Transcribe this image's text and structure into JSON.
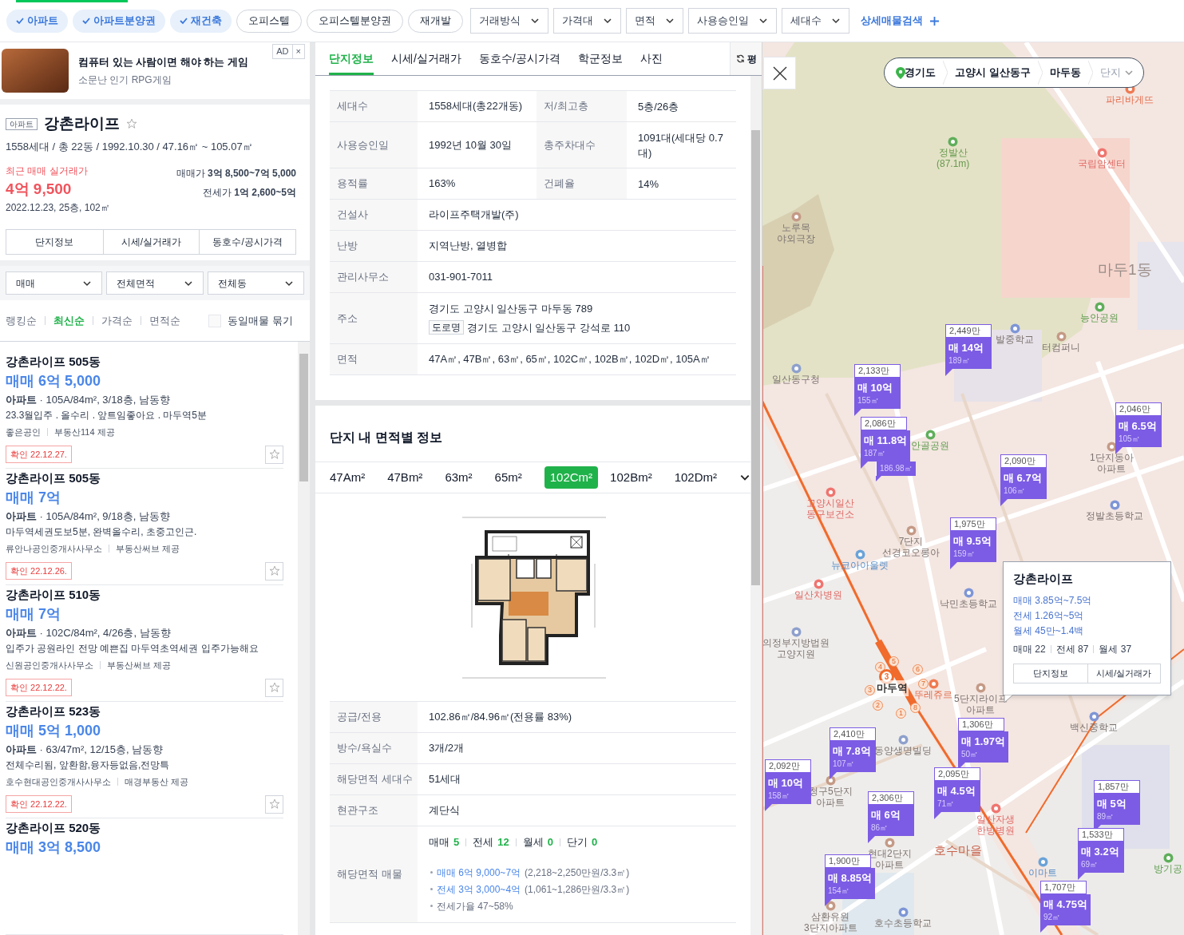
{
  "top_bar": {
    "type_filters": [
      {
        "label": "아파트",
        "selected": true
      },
      {
        "label": "아파트분양권",
        "selected": true
      },
      {
        "label": "재건축",
        "selected": true
      },
      {
        "label": "오피스텔",
        "selected": false
      },
      {
        "label": "오피스텔분양권",
        "selected": false
      },
      {
        "label": "재개발",
        "selected": false
      }
    ],
    "dropdowns": [
      "거래방식",
      "가격대",
      "면적",
      "사용승인일",
      "세대수"
    ],
    "detail_search": "상세매물검색"
  },
  "ad": {
    "badge": "AD",
    "close": "×",
    "title": "컴퓨터 있는 사람이면 해야 하는 게임",
    "subtitle": "소문난 인기 RPG게임"
  },
  "complex": {
    "tag": "아파트",
    "name": "강촌라이프",
    "favorite": false,
    "summary": "1558세대 / 총 22동 / 1992.10.30 / 47.16㎡ ~ 105.07㎡",
    "recent_label": "최근 매매 실거래가",
    "recent_price": "4억 9,500",
    "recent_detail": "2022.12.23, 25층, 102㎡",
    "sale_range": "매매가 **3억 8,500~7억 5,000**",
    "jeonse_range": "전세가 **1억 2,600~5억**",
    "buttons": [
      "단지정보",
      "시세/실거래가",
      "동호수/공시가격"
    ]
  },
  "list_filters": [
    "매매",
    "전체면적",
    "전체동"
  ],
  "sort": {
    "options": [
      {
        "label": "랭킹순",
        "selected": false
      },
      {
        "label": "최신순",
        "selected": true
      },
      {
        "label": "가격순",
        "selected": false
      },
      {
        "label": "면적순",
        "selected": false
      }
    ],
    "group_same": {
      "label": "동일매물 묶기",
      "checked": false
    }
  },
  "listings": [
    {
      "title": "강촌라이프 505동",
      "price": "매매 6억 5,000",
      "spec": "**아파트** · 105A/84m², 3/18층, 남동향",
      "description": "23.3월입주 . 올수리 . 앞트임좋아요 . 마두역5분",
      "agent": "좋은공인",
      "provider": "부동산114 제공",
      "confirmed": "확인 22.12.27.",
      "favorite": false
    },
    {
      "title": "강촌라이프 505동",
      "price": "매매 7억",
      "spec": "**아파트** · 105A/84m², 9/18층, 남동향",
      "description": "마두역세권도보5분, 완벽올수리, 초중고인근.",
      "agent": "류안나공인중개사사무소",
      "provider": "부동산써브 제공",
      "confirmed": "확인 22.12.26.",
      "favorite": false
    },
    {
      "title": "강촌라이프 510동",
      "price": "매매 7억",
      "spec": "**아파트** · 102C/84m², 4/26층, 남동향",
      "description": "입주가 공원라인 전망 예쁜집 마두역초역세권 입주가능해요",
      "agent": "신원공인중개사사무소",
      "provider": "부동산써브 제공",
      "confirmed": "확인 22.12.22.",
      "favorite": false
    },
    {
      "title": "강촌라이프 523동",
      "price": "매매 5억 1,000",
      "spec": "**아파트** · 63/47m², 12/15층, 남동향",
      "description": "전체수리됨, 앞환함,융자등없음,전망특",
      "agent": "호수현대공인중개사사무소",
      "provider": "매경부동산 제공",
      "confirmed": "확인 22.12.22.",
      "favorite": false
    },
    {
      "title": "강촌라이프 520동",
      "price": "매매 3억 8,500"
    }
  ],
  "detail_panel": {
    "tabs": [
      {
        "label": "단지정보",
        "selected": true
      },
      {
        "label": "시세/실거래가",
        "selected": false
      },
      {
        "label": "동호수/공시가격",
        "selected": false
      },
      {
        "label": "학군정보",
        "selected": false
      },
      {
        "label": "사진",
        "selected": false
      }
    ],
    "unit_toggle": "평",
    "info_rows": [
      {
        "kind": "pair",
        "label": "세대수",
        "value": "1558세대(총22개동)",
        "label_2": "저/최고층",
        "value_2": "5층/26층"
      },
      {
        "kind": "pair",
        "label": "사용승인일",
        "value": "1992년 10월 30일",
        "label_2": "총주차대수",
        "value_2": "1091대(세대당 0.7대)"
      },
      {
        "kind": "pair",
        "label": "용적률",
        "value": "163%",
        "label_2": "건폐율",
        "value_2": "14%"
      },
      {
        "kind": "single",
        "label": "건설사",
        "value": "라이프주택개발(주)"
      },
      {
        "kind": "single",
        "label": "난방",
        "value": "지역난방, 열병합"
      },
      {
        "kind": "single",
        "label": "관리사무소",
        "value": "031-901-7011"
      },
      {
        "kind": "address",
        "label": "주소",
        "value": "경기도 고양시 일산동구 마두동 789",
        "road_tag": "도로명",
        "road_address": "경기도 고양시 일산동구 강석로 110"
      },
      {
        "kind": "single",
        "label": "면적",
        "value": "47A㎡, 47B㎡, 63㎡, 65㎡, 102C㎡, 102B㎡, 102D㎡, 105A㎡"
      }
    ],
    "area_section": {
      "title": "단지 내 면적별 정보",
      "areas": [
        {
          "label": "47Am²",
          "selected": false
        },
        {
          "label": "47Bm²",
          "selected": false
        },
        {
          "label": "63m²",
          "selected": false
        },
        {
          "label": "65m²",
          "selected": false
        },
        {
          "label": "102Cm²",
          "selected": true
        },
        {
          "label": "102Bm²",
          "selected": false
        },
        {
          "label": "102Dm²",
          "selected": false
        }
      ]
    },
    "area_rows": [
      {
        "kind": "single",
        "label": "공급/전용",
        "value": "102.86㎡/84.96㎡(전용률 83%)"
      },
      {
        "kind": "single",
        "label": "방수/욕실수",
        "value": "3개/2개"
      },
      {
        "kind": "single",
        "label": "해당면적 세대수",
        "value": "51세대"
      },
      {
        "kind": "single",
        "label": "현관구조",
        "value": "계단식"
      },
      {
        "kind": "listings",
        "label": "해당면적 매물",
        "counts": [
          {
            "label": "매매",
            "count": "5"
          },
          {
            "label": "전세",
            "count": "12"
          },
          {
            "label": "월세",
            "count": "0"
          },
          {
            "label": "단기",
            "count": "0"
          }
        ],
        "ranges": [
          {
            "price": "매매 6억 9,000~7억",
            "detail": "(2,218~2,250만원/3.3㎡)"
          },
          {
            "price": "전세 3억 3,000~4억",
            "detail": "(1,061~1,286만원/3.3㎡)"
          },
          {
            "detail": "전세가율 47~58%"
          }
        ]
      }
    ]
  },
  "map": {
    "breadcrumb": {
      "items": [
        "경기도",
        "고양시 일산동구",
        "마두동"
      ],
      "dropdown": "단지"
    },
    "labels": [
      {
        "kind": "food",
        "text": "파리바게뜨"
      },
      {
        "kind": "mountain",
        "text": "정발산\n(87.1m)"
      },
      {
        "kind": "hospital",
        "text": "국립암센터"
      },
      {
        "kind": "place",
        "text": "노루목\n야외극장"
      },
      {
        "kind": "district",
        "text": "마두1동"
      },
      {
        "kind": "park",
        "text": "능안공원"
      },
      {
        "kind": "school",
        "text": "발중학교"
      },
      {
        "kind": "place",
        "text": "터컴퍼니"
      },
      {
        "kind": "office",
        "text": "일산동구청"
      },
      {
        "kind": "park",
        "text": "안골공원"
      },
      {
        "kind": "place",
        "text": "1단지동아\n아파트"
      },
      {
        "kind": "school",
        "text": "정발초등학교"
      },
      {
        "kind": "place",
        "text": "7단지\n선경코오롱아"
      },
      {
        "kind": "shop",
        "text": "뉴코아아울렛"
      },
      {
        "kind": "hospital",
        "text": "고양시일산\n동구보건소"
      },
      {
        "kind": "hospital",
        "text": "일산차병원"
      },
      {
        "kind": "school",
        "text": "낙민초등학교"
      },
      {
        "kind": "office",
        "text": "의정부지방법원\n고양지원"
      },
      {
        "kind": "food",
        "text": "뚜레쥬르"
      },
      {
        "kind": "place",
        "text": "5단지라이프\n아파트"
      },
      {
        "kind": "school",
        "text": "백신중학교"
      },
      {
        "kind": "office",
        "text": "동양생명빌딩"
      },
      {
        "kind": "place",
        "text": "청구5단지\n아파트"
      },
      {
        "kind": "hospital",
        "text": "일산자생\n한방병원"
      },
      {
        "kind": "place",
        "text": "현대2단지\n아파트"
      },
      {
        "kind": "village",
        "text": "호수마을"
      },
      {
        "kind": "shop",
        "text": "이마트"
      },
      {
        "kind": "place",
        "text": "삼환유원\n3단지아파트"
      },
      {
        "kind": "school",
        "text": "호수초등학교"
      },
      {
        "kind": "park",
        "text": "방기공"
      }
    ],
    "station": {
      "name": "마두역",
      "line": "3",
      "exits": [
        "1",
        "2",
        "3",
        "4",
        "5",
        "6",
        "7",
        "8"
      ]
    },
    "markers": [
      {
        "unit_price": "2,449만",
        "price": "매 14억",
        "area": "189㎡"
      },
      {
        "unit_price": "2,133만",
        "price": "매 10억",
        "area": "155㎡"
      },
      {
        "unit_price": "2,086만",
        "price": "매 11.8억",
        "area": "187㎡",
        "extra_area": "186.98㎡"
      },
      {
        "unit_price": "2,046만",
        "price": "매 6.5억",
        "area": "105㎡"
      },
      {
        "unit_price": "2,090만",
        "price": "매 6.7억",
        "area": "106㎡"
      },
      {
        "unit_price": "1,975만",
        "price": "매 9.5억",
        "area": "159㎡"
      },
      {
        "unit_price": "1,306만",
        "price": "매 1.97억",
        "area": "50㎡"
      },
      {
        "unit_price": "2,410만",
        "price": "매 7.8억",
        "area": "107㎡"
      },
      {
        "unit_price": "2,092만",
        "price": "매 10억",
        "area": "158㎡"
      },
      {
        "unit_price": "2,095만",
        "price": "매 4.5억",
        "area": "71㎡"
      },
      {
        "unit_price": "2,306만",
        "price": "매 6억",
        "area": "86㎡"
      },
      {
        "unit_price": "1,857만",
        "price": "매 5억",
        "area": "89㎡"
      },
      {
        "unit_price": "1,533만",
        "price": "매 3.2억",
        "area": "69㎡"
      },
      {
        "unit_price": "1,900만",
        "price": "매 8.85억",
        "area": "154㎡"
      },
      {
        "unit_price": "1,707만",
        "price": "매 4.75억",
        "area": "92㎡"
      }
    ],
    "popup": {
      "title": "강촌라이프",
      "ranges": [
        "매매 3.85억~7.5억",
        "전세 1.26억~5억",
        "월세 45만~1.4백"
      ],
      "counts": [
        "매매 22",
        "전세 87",
        "월세 37"
      ],
      "buttons": [
        "단지정보",
        "시세/실거래가"
      ]
    }
  }
}
